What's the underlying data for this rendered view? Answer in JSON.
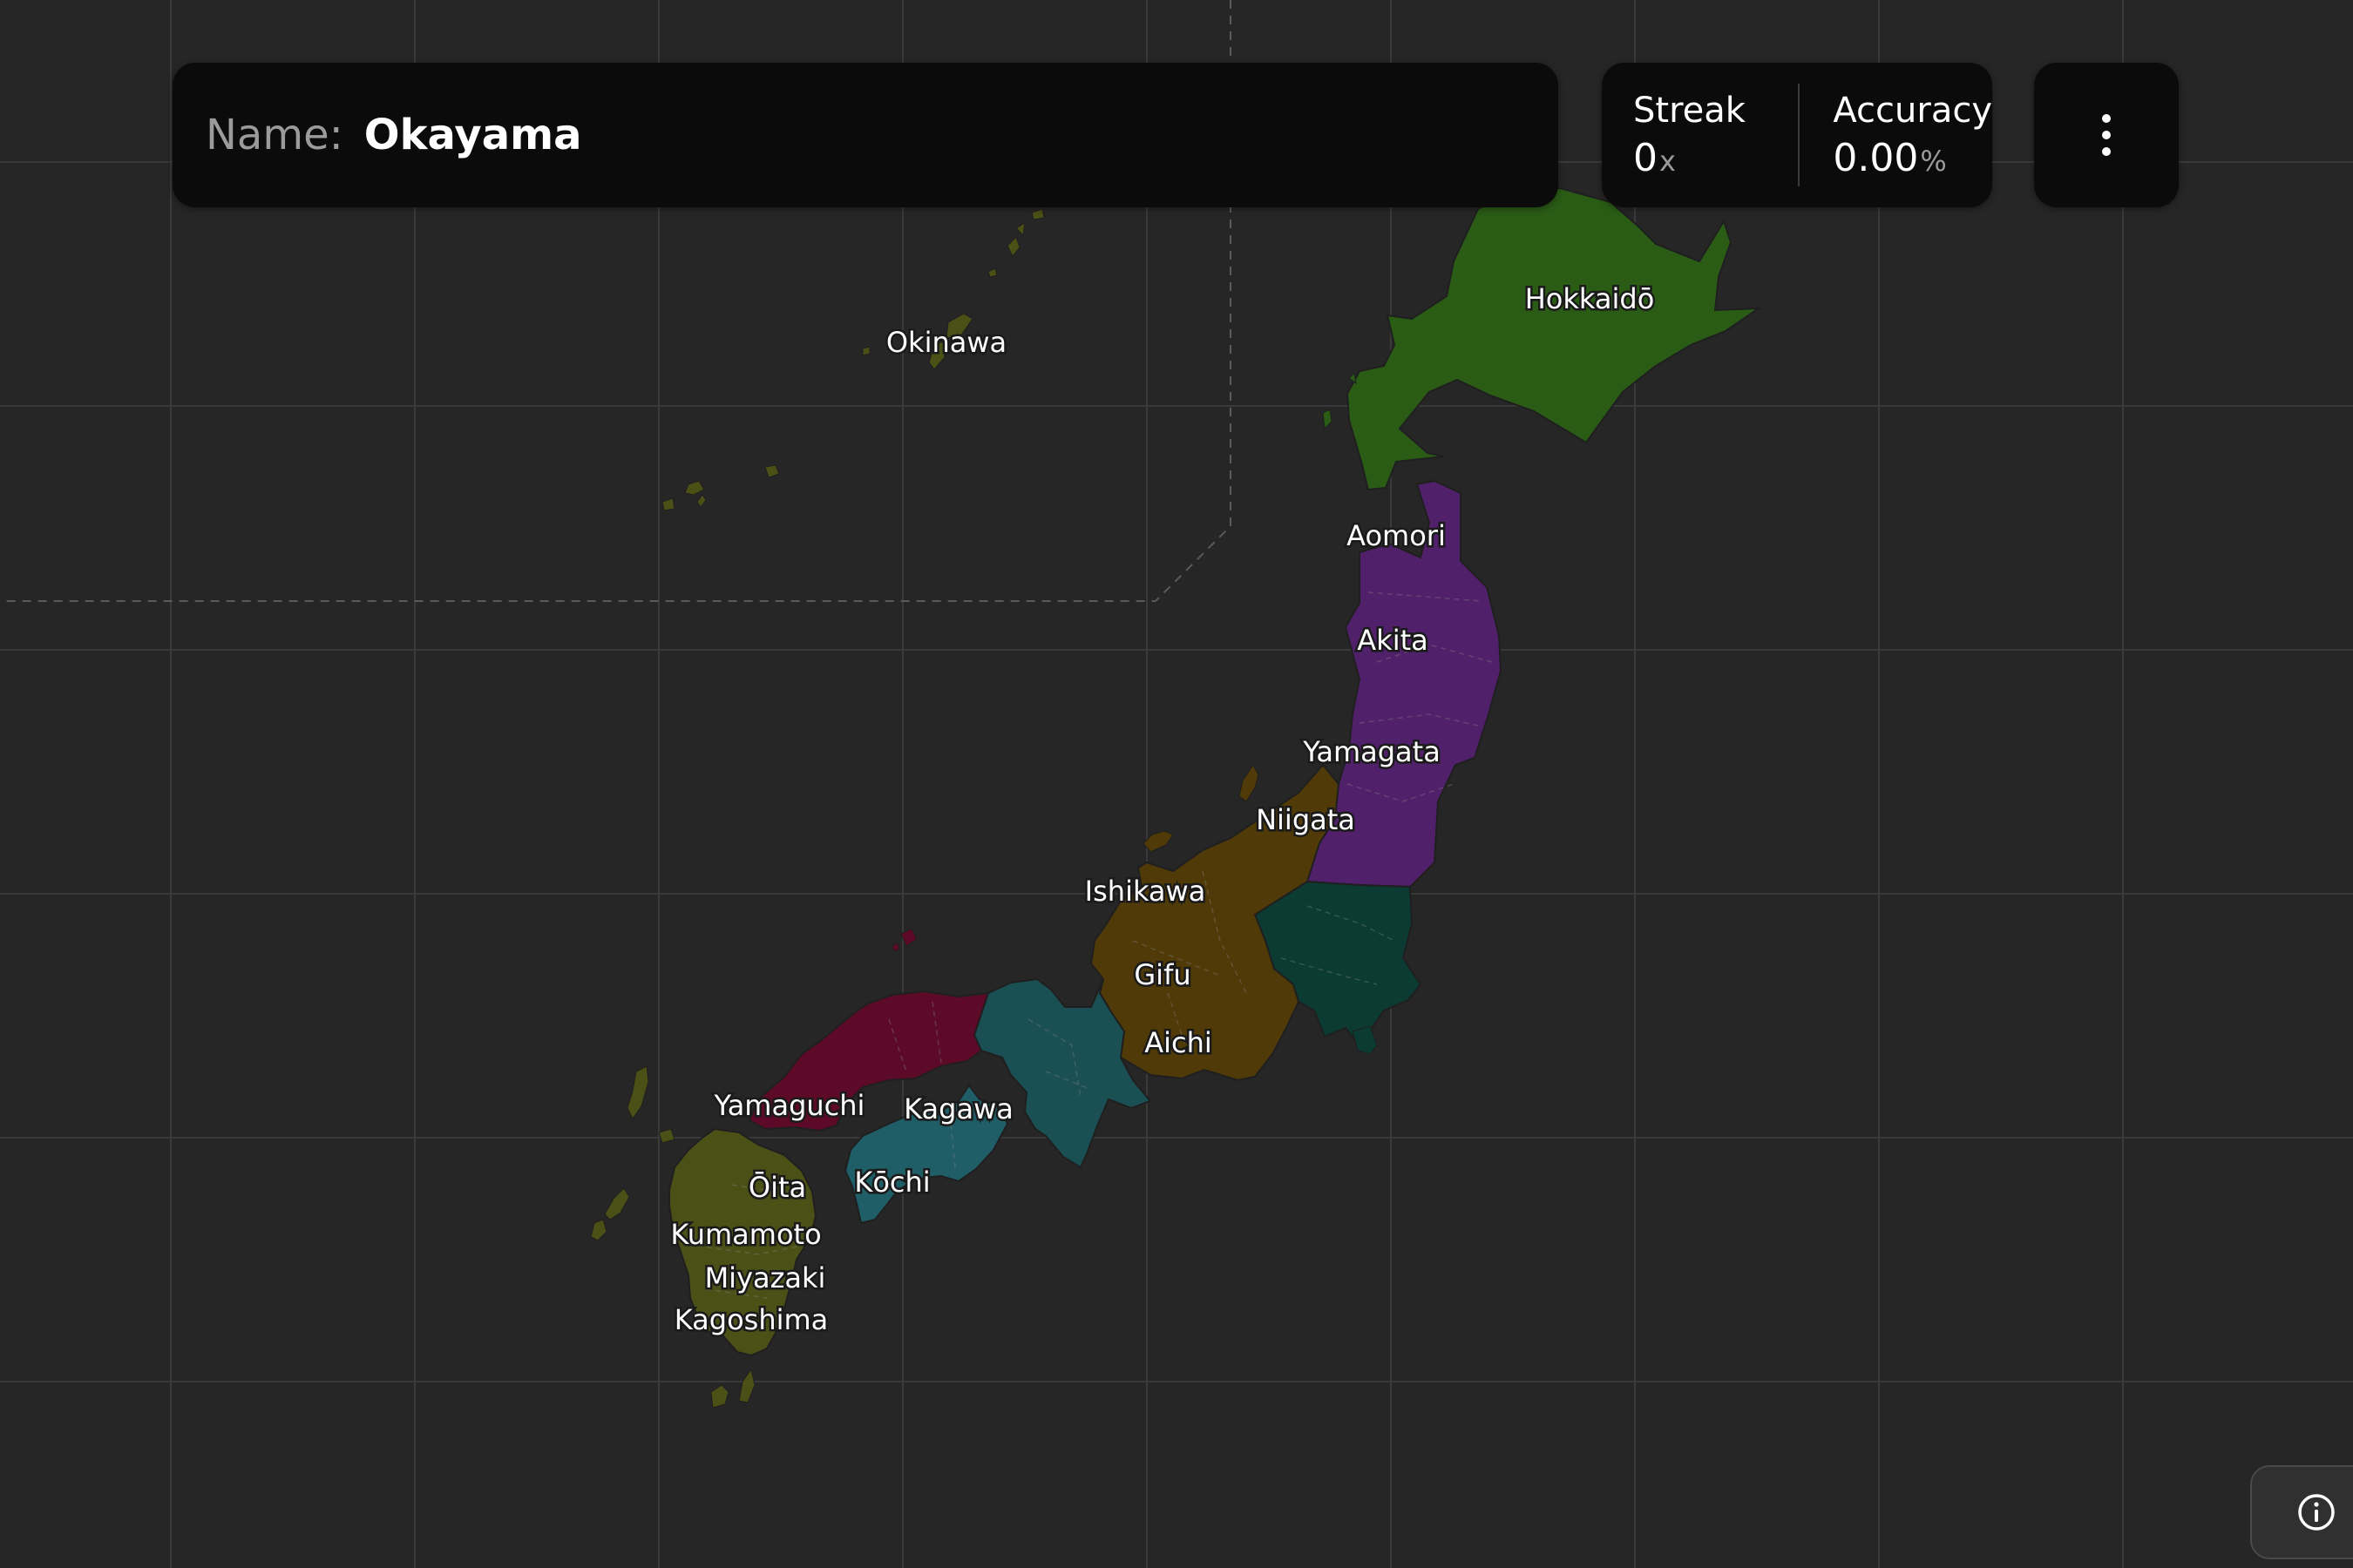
{
  "prompt": {
    "label": "Name:",
    "value": "Okayama"
  },
  "stats": {
    "streak": {
      "title": "Streak",
      "value": "0",
      "unit": "x"
    },
    "accuracy": {
      "title": "Accuracy",
      "value": "0.00",
      "unit": "%"
    }
  },
  "menu": {
    "icon": "more-vertical-icon"
  },
  "info": {
    "icon": "info-icon"
  },
  "map": {
    "colors": {
      "background": "#262626",
      "grid": "#3a3a3a",
      "hokkaido": "#2a5c16",
      "tohoku": "#51206b",
      "kanto": "#0b3b33",
      "chubu": "#4f3a08",
      "kansai": "#1a4f53",
      "chugoku": "#5c0a28",
      "shikoku": "#1f5e66",
      "kyushu": "#4b5016"
    },
    "labels": {
      "okinawa": "Okinawa",
      "hokkaido": "Hokkaidō",
      "aomori": "Aomori",
      "akita": "Akita",
      "yamagata": "Yamagata",
      "niigata": "Niigata",
      "ishikawa": "Ishikawa",
      "gifu": "Gifu",
      "aichi": "Aichi",
      "yamaguchi": "Yamaguchi",
      "kagawa": "Kagawa",
      "kochi": "Kōchi",
      "oita": "Ōita",
      "kumamoto": "Kumamoto",
      "miyazaki": "Miyazaki",
      "kagoshima": "Kagoshima"
    }
  }
}
